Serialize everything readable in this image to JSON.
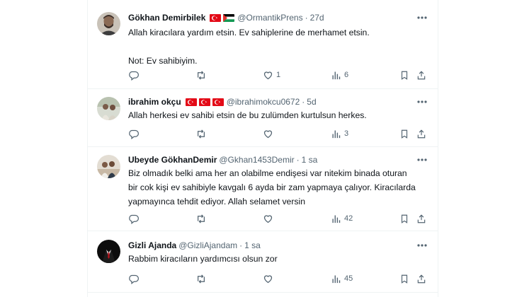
{
  "tweets": [
    {
      "name": "Gökhan Demirbilek",
      "handle": "@OrmantikPrens",
      "time": "27d",
      "flags": [
        "tr",
        "ps"
      ],
      "lines": [
        "Allah kiracılara yardım etsin. Ev sahiplerine de merhamet etsin.",
        "",
        "Not: Ev sahibiyim."
      ],
      "replies": "",
      "reposts": "",
      "likes": "1",
      "views": "6"
    },
    {
      "name": "ibrahim okçu",
      "handle": "@ibrahimokcu0672",
      "time": "5d",
      "flags": [
        "tr",
        "tr",
        "tr"
      ],
      "lines": [
        "Allah herkesi ev sahibi etsin de bu zulümden kurtulsun herkes."
      ],
      "replies": "",
      "reposts": "",
      "likes": "",
      "views": "3"
    },
    {
      "name": "Ubeyde GökhanDemir",
      "handle": "@Gkhan1453Demir",
      "time": "1 sa",
      "flags": [],
      "lines": [
        "Biz olmadık belki ama her an olabilme endişesi var nitekim binada oturan",
        "bir cok kişi ev sahibiyle kavgalı 6 ayda bir zam yapmaya çalıyor. Kiracılarda",
        "yapmayınca tehdit ediyor. Allah selamet versin"
      ],
      "replies": "",
      "reposts": "",
      "likes": "",
      "views": "42"
    },
    {
      "name": "Gizli Ajanda",
      "handle": "@GizliAjandam",
      "time": "1 sa",
      "flags": [],
      "lines": [
        "Rabbim kiracıların yardımcısı olsun zor"
      ],
      "replies": "",
      "reposts": "",
      "likes": "",
      "views": "45"
    }
  ]
}
